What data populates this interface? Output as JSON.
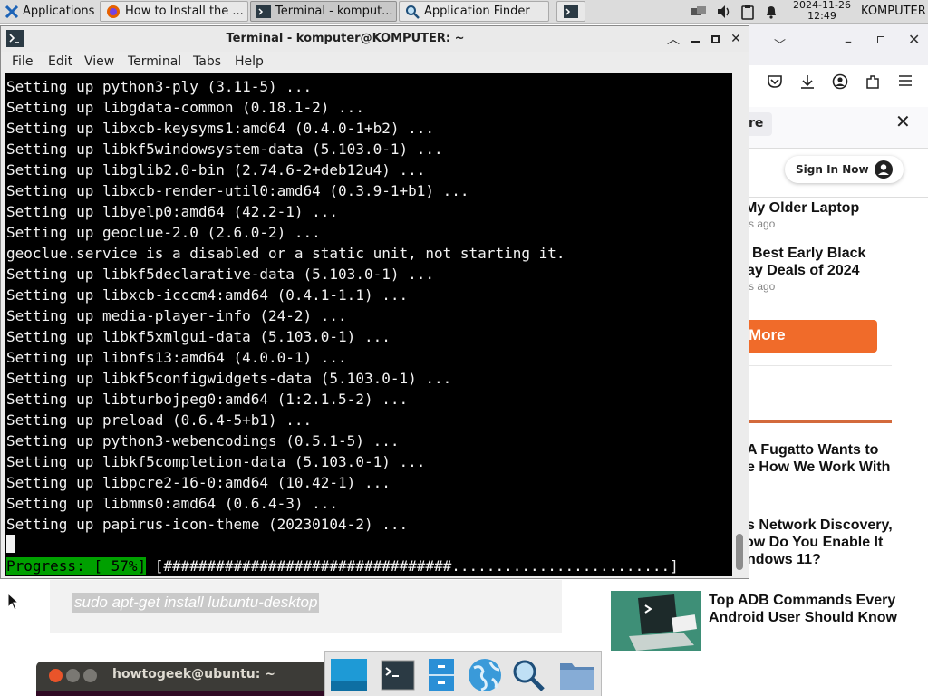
{
  "panel": {
    "applications_label": "Applications",
    "applications_suffix": "☰",
    "tasks": [
      {
        "label": "How to Install the ..."
      },
      {
        "label": "Terminal - komput..."
      },
      {
        "label": "Application Finder"
      }
    ],
    "date": "2024-11-26",
    "time": "12:49",
    "user": "KOMPUTER"
  },
  "terminal": {
    "title": "Terminal - komputer@KOMPUTER: ~",
    "menu": [
      "File",
      "Edit",
      "View",
      "Terminal",
      "Tabs",
      "Help"
    ],
    "lines": [
      "Setting up python3-ply (3.11-5) ...",
      "Setting up libgdata-common (0.18.1-2) ...",
      "Setting up libxcb-keysyms1:amd64 (0.4.0-1+b2) ...",
      "Setting up libkf5windowsystem-data (5.103.0-1) ...",
      "Setting up libglib2.0-bin (2.74.6-2+deb12u4) ...",
      "Setting up libxcb-render-util0:amd64 (0.3.9-1+b1) ...",
      "Setting up libyelp0:amd64 (42.2-1) ...",
      "Setting up geoclue-2.0 (2.6.0-2) ...",
      "geoclue.service is a disabled or a static unit, not starting it.",
      "Setting up libkf5declarative-data (5.103.0-1) ...",
      "Setting up libxcb-icccm4:amd64 (0.4.1-1.1) ...",
      "Setting up media-player-info (24-2) ...",
      "Setting up libkf5xmlgui-data (5.103.0-1) ...",
      "Setting up libnfs13:amd64 (4.0.0-1) ...",
      "Setting up libkf5configwidgets-data (5.103.0-1) ...",
      "Setting up libturbojpeg0:amd64 (1:2.1.5-2) ...",
      "Setting up preload (0.6.4-5+b1) ...",
      "Setting up python3-webencodings (0.5.1-5) ...",
      "Setting up libkf5completion-data (5.103.0-1) ...",
      "Setting up libpcre2-16-0:amd64 (10.42-1) ...",
      "Setting up libmms0:amd64 (0.6.4-3) ...",
      "Setting up papirus-icon-theme (20230104-2) ..."
    ],
    "progress_label": "Progress: [ 57%]",
    "progress_bar": " [#################################.........................]",
    "progress_value": 0.57
  },
  "browser": {
    "findbar_fragment": "re",
    "sign_in_label": "Sign In Now",
    "articles": [
      {
        "title_line1": "My Older Laptop",
        "meta": "rs ago"
      },
      {
        "title_line1": "Best Early Black",
        "title_line2": "ay Deals of 2024",
        "meta": "rs ago"
      },
      {
        "title_line1": "A Fugatto Wants to",
        "title_line2": "e How We Work With"
      },
      {
        "title_line1": "s Network Discovery,",
        "title_line2": "ow Do You Enable It",
        "title_line3": "ndows 11?"
      }
    ],
    "more_button": "More",
    "featured_title_line1": "Top ADB Commands Every",
    "featured_title_line2": "Android User Should Know",
    "code_snippet": "sudo apt-get install lubuntu-desktop",
    "accent_color": "#f06b2a"
  },
  "ubuntu_terminal": {
    "title": "howtogeek@ubuntu: ~"
  },
  "dock": {
    "items": [
      "show-desktop",
      "terminal",
      "file-cabinet",
      "web-browser",
      "app-finder",
      "home-folder"
    ]
  }
}
